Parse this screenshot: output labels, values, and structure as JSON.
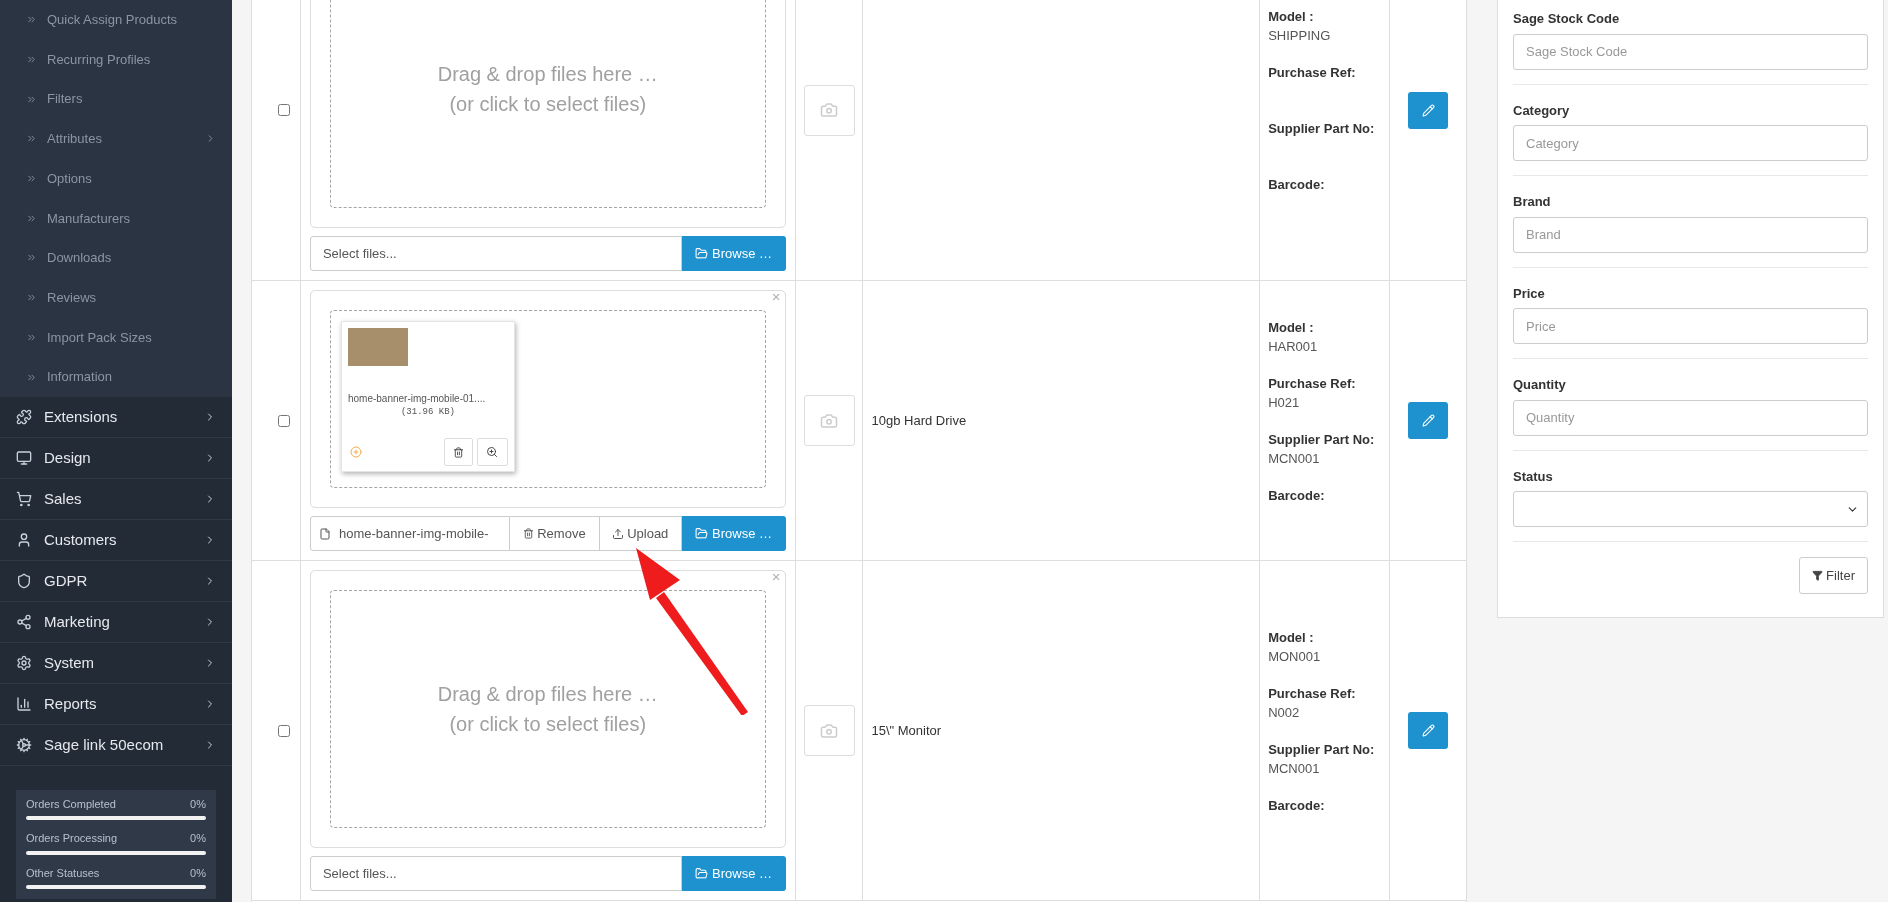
{
  "sidebar": {
    "sub_items": [
      {
        "label": "Quick Assign Products",
        "has_children": false
      },
      {
        "label": "Recurring Profiles",
        "has_children": false
      },
      {
        "label": "Filters",
        "has_children": false
      },
      {
        "label": "Attributes",
        "has_children": true
      },
      {
        "label": "Options",
        "has_children": false
      },
      {
        "label": "Manufacturers",
        "has_children": false
      },
      {
        "label": "Downloads",
        "has_children": false
      },
      {
        "label": "Reviews",
        "has_children": false
      },
      {
        "label": "Import Pack Sizes",
        "has_children": false
      },
      {
        "label": "Information",
        "has_children": false
      }
    ],
    "items": [
      {
        "label": "Extensions"
      },
      {
        "label": "Design"
      },
      {
        "label": "Sales"
      },
      {
        "label": "Customers"
      },
      {
        "label": "GDPR"
      },
      {
        "label": "Marketing"
      },
      {
        "label": "System"
      },
      {
        "label": "Reports"
      },
      {
        "label": "Sage link 50ecom"
      }
    ],
    "stats": [
      {
        "label": "Orders Completed",
        "value": "0%",
        "level": 0
      },
      {
        "label": "Orders Processing",
        "value": "0%",
        "level": 0
      },
      {
        "label": "Other Statuses",
        "value": "0%",
        "level": 0
      }
    ]
  },
  "rows": [
    {
      "checked": false,
      "upload": {
        "kind": "empty",
        "drop_title": "Drag & drop files here …",
        "drop_subtitle": "(or click to select files)",
        "placeholder": "Select files...",
        "browse": "Browse …"
      },
      "details": [
        {
          "label": "Model :",
          "value": "SHIPPING"
        },
        {
          "label": "Purchase Ref:"
        },
        {
          "label": "Supplier Part No:"
        },
        {
          "label": "Barcode:"
        }
      ]
    },
    {
      "checked": false,
      "upload": {
        "kind": "file",
        "close": "×",
        "file_name": "home-banner-img-mobile-01....",
        "file_size": "(31.96 KB)",
        "caption": "home-banner-img-mobile-",
        "remove": "Remove",
        "upload": "Upload",
        "browse": "Browse …"
      },
      "name": "10gb Hard Drive",
      "details": [
        {
          "label": "Model :",
          "value": "HAR001"
        },
        {
          "label": "Purchase Ref:",
          "value": "H021"
        },
        {
          "label": "Supplier Part No:",
          "value": "MCN001"
        },
        {
          "label": "Barcode:"
        }
      ]
    },
    {
      "checked": false,
      "upload": {
        "kind": "empty",
        "close": "×",
        "drop_title": "Drag & drop files here …",
        "drop_subtitle": "(or click to select files)",
        "placeholder": "Select files...",
        "browse": "Browse …"
      },
      "name": "15\\\" Monitor",
      "details": [
        {
          "label": "Model :",
          "value": "MON001"
        },
        {
          "label": "Purchase Ref:",
          "value": "N002"
        },
        {
          "label": "Supplier Part No:",
          "value": "MCN001"
        },
        {
          "label": "Barcode:"
        }
      ]
    }
  ],
  "filter": {
    "fields": [
      {
        "kind": "input",
        "label": "Sage Stock Code",
        "placeholder": "Sage Stock Code"
      },
      {
        "kind": "input",
        "label": "Category",
        "placeholder": "Category"
      },
      {
        "kind": "input",
        "label": "Brand",
        "placeholder": "Brand"
      },
      {
        "kind": "input",
        "label": "Price",
        "placeholder": "Price"
      },
      {
        "kind": "input",
        "label": "Quantity",
        "placeholder": "Quantity"
      },
      {
        "kind": "select",
        "label": "Status"
      }
    ],
    "button": "Filter"
  }
}
